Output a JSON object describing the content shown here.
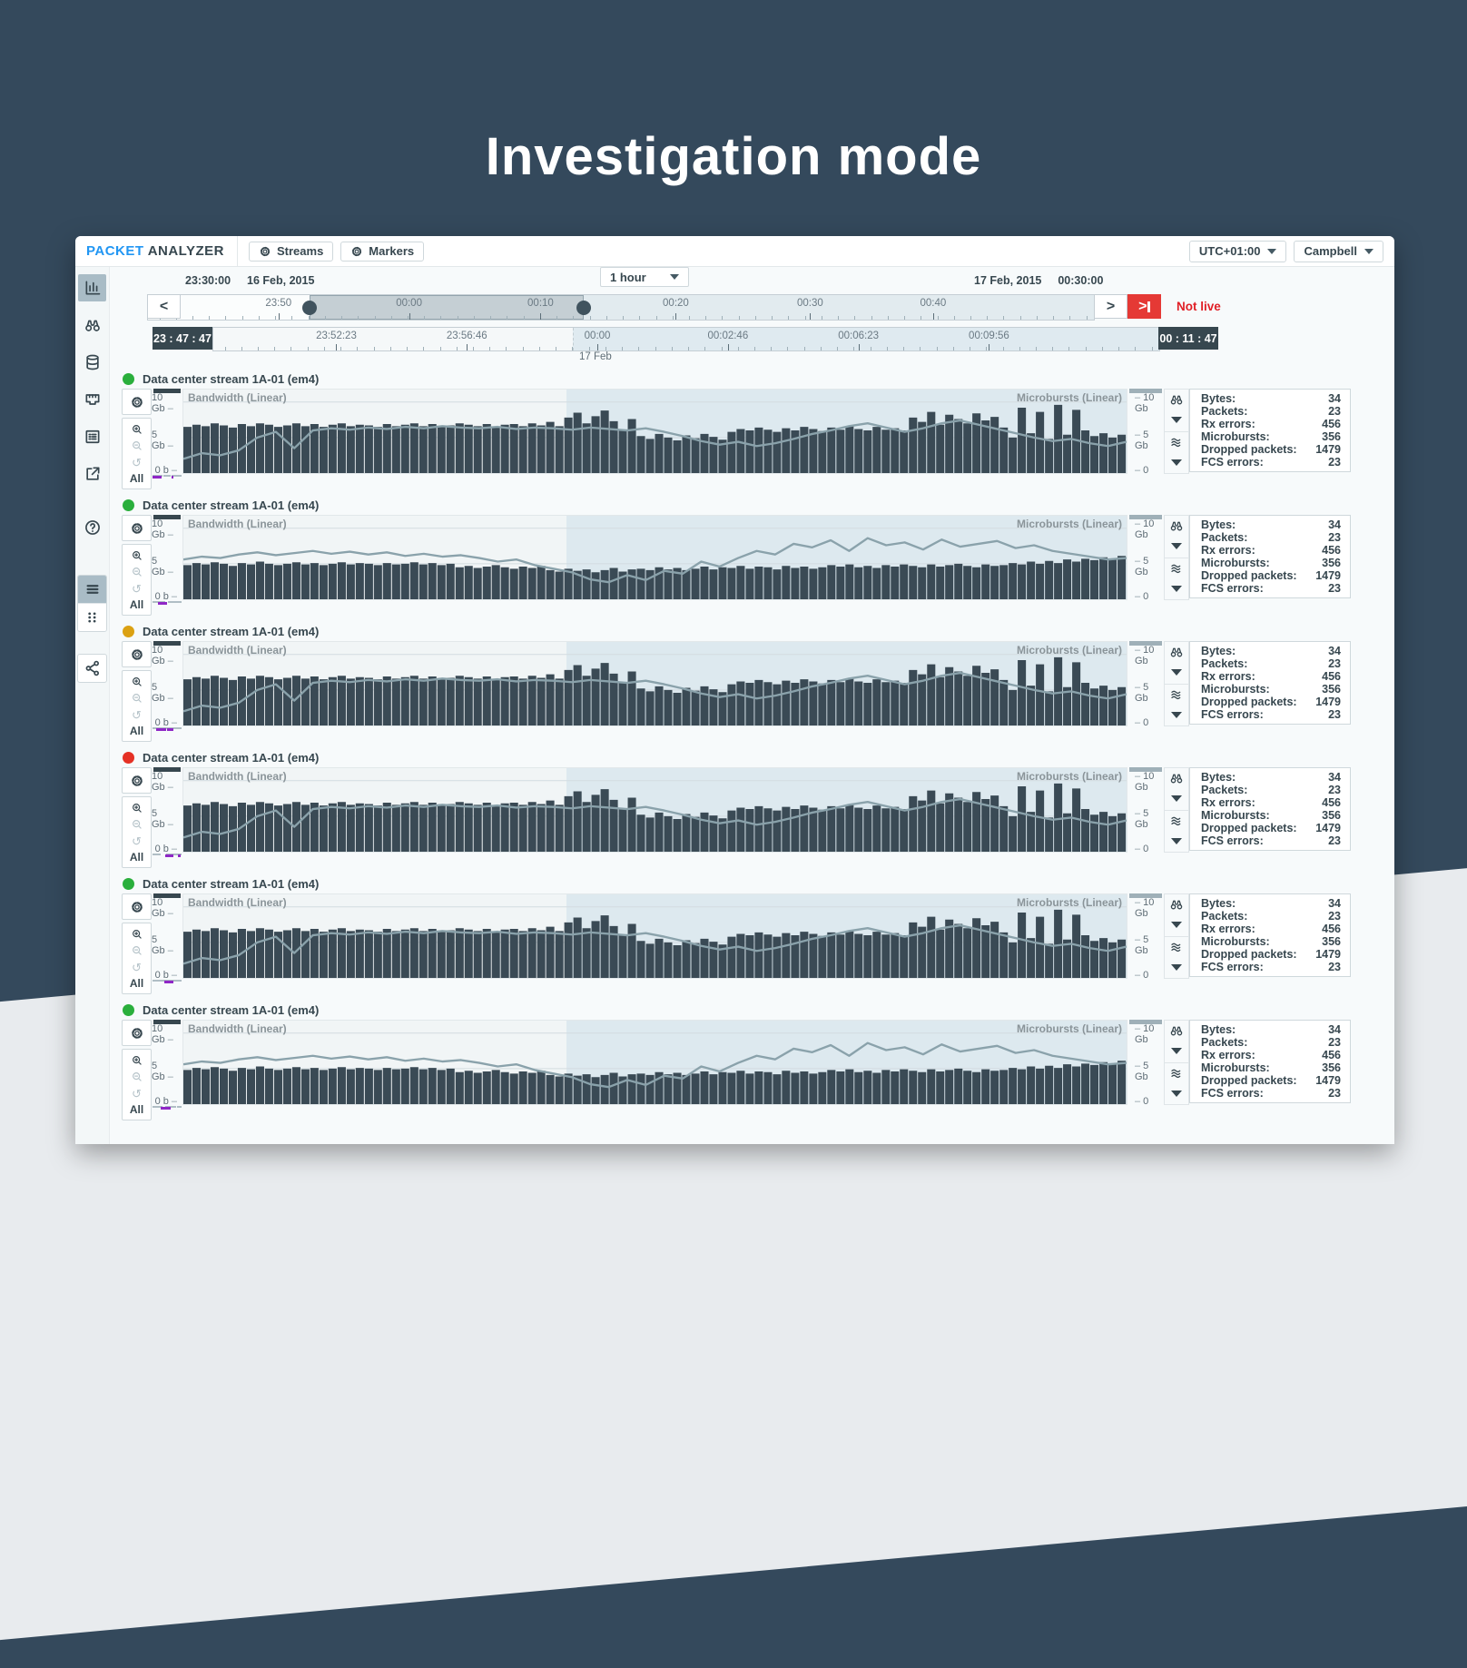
{
  "page": {
    "title": "Investigation mode"
  },
  "header": {
    "brand_part1": "PACKET",
    "brand_part2": "ANALYZER",
    "streams_button": "Streams",
    "markers_button": "Markers",
    "timezone": "UTC+01:00",
    "user": "Campbell"
  },
  "sidebar": {
    "items": [
      {
        "icon": "bar-chart-icon",
        "name": "sidebar-item-charts",
        "active": true
      },
      {
        "icon": "binoculars-icon",
        "name": "sidebar-item-search",
        "active": false
      },
      {
        "icon": "database-icon",
        "name": "sidebar-item-storage",
        "active": false
      },
      {
        "icon": "ethernet-port-icon",
        "name": "sidebar-item-interfaces",
        "active": false
      },
      {
        "icon": "list-details-icon",
        "name": "sidebar-item-details",
        "active": false
      },
      {
        "icon": "external-link-icon",
        "name": "sidebar-item-open",
        "active": false
      }
    ],
    "help_icon": "help-icon",
    "view_toggle": [
      {
        "icon": "list-view-icon",
        "name": "view-list-button",
        "active": true
      },
      {
        "icon": "grid-view-icon",
        "name": "view-grid-button",
        "active": false
      }
    ],
    "share_icon": "share-icon"
  },
  "timebar": {
    "left_time": "23:30:00",
    "left_date": "16 Feb, 2015",
    "right_date": "17 Feb, 2015",
    "right_time": "00:30:00",
    "range_select": "1 hour",
    "not_live": "Not live",
    "start_badge": "23 : 47 : 47",
    "end_badge": "00 : 11 : 47",
    "day_label": "17 Feb",
    "overview_ticks": [
      {
        "label": "23:50",
        "pos": 13.8
      },
      {
        "label": "00:00",
        "pos": 27.6
      },
      {
        "label": "00:10",
        "pos": 41.5
      },
      {
        "label": "00:20",
        "pos": 55.8
      },
      {
        "label": "00:30",
        "pos": 70.0
      },
      {
        "label": "00:40",
        "pos": 83.0
      }
    ],
    "selection": {
      "start": 17.1,
      "end": 46.1
    },
    "detail_ticks": [
      {
        "label": "23:52:23",
        "pos": 13.0
      },
      {
        "label": "23:56:46",
        "pos": 26.8
      },
      {
        "label": "00:00",
        "pos": 40.6
      },
      {
        "label": "00:02:46",
        "pos": 54.4
      },
      {
        "label": "00:06:23",
        "pos": 68.2
      },
      {
        "label": "00:09:56",
        "pos": 82.0
      }
    ],
    "detail_highlight_start": 38.0
  },
  "chart_labels": {
    "left": "Bandwidth (Linear)",
    "right": "Microbursts (Linear)"
  },
  "axis": {
    "left": [
      "10 Gb",
      "5 Gb",
      "0 b"
    ],
    "right": [
      "10 Gb",
      "5 Gb",
      "0"
    ],
    "all_label": "All"
  },
  "stats": {
    "labels": [
      "Bytes:",
      "Packets:",
      "Rx errors:",
      "Microbursts:",
      "Dropped packets:",
      "FCS errors:"
    ],
    "values": [
      "34",
      "23",
      "456",
      "356",
      "1479",
      "23"
    ]
  },
  "colors": {
    "brand_blue": "#2196f3",
    "live_red": "#e53935",
    "dark_slate": "#37474f",
    "bar_fill": "#3a4a55",
    "line_stroke": "#8aa2ab",
    "purple_marker": "#8f27c6",
    "gray_marker": "#b0bec5",
    "marker_palette": {
      "r": "#e53935",
      "o": "#f57c00",
      "y": "#fbc02d",
      "g": "#43a047",
      "t": "#26a69a",
      "c": "#00acc1"
    }
  },
  "series": {
    "bars_a": [
      65,
      68,
      66,
      70,
      67,
      64,
      69,
      66,
      70,
      68,
      65,
      67,
      70,
      66,
      69,
      65,
      68,
      70,
      66,
      68,
      67,
      65,
      69,
      66,
      68,
      70,
      66,
      69,
      65,
      67,
      70,
      68,
      66,
      69,
      65,
      68,
      69,
      66,
      70,
      67,
      72,
      66,
      78,
      85,
      70,
      80,
      88,
      73,
      60,
      76,
      52,
      48,
      55,
      50,
      46,
      53,
      49,
      55,
      51,
      47,
      58,
      62,
      60,
      64,
      61,
      58,
      63,
      60,
      65,
      62,
      59,
      64,
      61,
      66,
      62,
      60,
      65,
      61,
      63,
      60,
      78,
      72,
      86,
      68,
      82,
      76,
      70,
      84,
      74,
      79,
      64,
      50,
      92,
      56,
      86,
      48,
      96,
      54,
      89,
      60,
      52,
      56,
      50,
      54
    ],
    "line_a": [
      20,
      28,
      25,
      32,
      50,
      58,
      35,
      60,
      63,
      61,
      64,
      62,
      65,
      63,
      66,
      64,
      63,
      65,
      62,
      64,
      63,
      61,
      64,
      62,
      60,
      63,
      58,
      52,
      45,
      40,
      44,
      38,
      42,
      48,
      55,
      60,
      66,
      70,
      64,
      58,
      63,
      70,
      74,
      68,
      62,
      56,
      50,
      45,
      48,
      42,
      38,
      44
    ],
    "bars_b": [
      48,
      51,
      49,
      52,
      50,
      47,
      51,
      49,
      53,
      50,
      48,
      50,
      52,
      49,
      51,
      48,
      50,
      52,
      49,
      51,
      50,
      48,
      51,
      49,
      50,
      52,
      49,
      51,
      48,
      50,
      45,
      47,
      44,
      46,
      48,
      45,
      43,
      46,
      44,
      47,
      41,
      39,
      43,
      40,
      42,
      38,
      41,
      44,
      39,
      42,
      43,
      41,
      45,
      42,
      44,
      41,
      43,
      46,
      42,
      45,
      44,
      47,
      43,
      46,
      45,
      42,
      47,
      44,
      46,
      43,
      45,
      48,
      46,
      49,
      45,
      47,
      44,
      48,
      46,
      49,
      47,
      45,
      49,
      46,
      48,
      50,
      47,
      45,
      49,
      47,
      48,
      51,
      49,
      53,
      50,
      54,
      51,
      56,
      53,
      57,
      55,
      59,
      57,
      61
    ],
    "line_b": [
      56,
      60,
      58,
      63,
      66,
      62,
      65,
      68,
      64,
      67,
      63,
      66,
      61,
      64,
      60,
      62,
      58,
      53,
      56,
      48,
      43,
      38,
      28,
      24,
      34,
      27,
      40,
      36,
      53,
      46,
      58,
      68,
      63,
      78,
      73,
      83,
      68,
      86,
      76,
      80,
      70,
      84,
      74,
      78,
      82,
      72,
      76,
      68,
      64,
      60,
      56,
      58
    ],
    "markers_a": "-gyr-or--ryy-g----orro-yr-----g-ry-oyr-ryo-yrr-roy-ryr-or-tgy-ryg--toyr-yro-gy-oyy-o--rry-ro-yr--orr-oyrogy-ryr-tr-ygr-",
    "markers_b": "--ryo--yy-r---g-oy--rro---ryy--t--or--ryr-gy--o-ryo--rry--gor--yro--ryy--tr--oy--rgy--ro--yrr--o--gy--ryo--rr--yor--gy-"
  },
  "streams": [
    {
      "title": "Data center stream 1A-01 (em4)",
      "dot_color": "#2aaf3c",
      "bars": "bars_a",
      "line": "line_a",
      "markers": "markers_a",
      "gray_lines": [
        [
          2,
          35
        ],
        [
          38,
          62
        ],
        [
          64,
          97
        ]
      ],
      "purple_lines": [
        [
          3,
          31
        ],
        [
          64,
          72
        ]
      ]
    },
    {
      "title": "Data center stream 1A-01 (em4)",
      "dot_color": "#2aaf3c",
      "bars": "bars_b",
      "line": "line_b",
      "markers": "markers_b",
      "gray_lines": [
        [
          2,
          45
        ],
        [
          52,
          97
        ]
      ],
      "purple_lines": [
        [
          22,
          50
        ]
      ]
    },
    {
      "title": "Data center stream 1A-01 (em4)",
      "dot_color": "#dba112",
      "bars": "bars_a",
      "line": "line_a",
      "markers": "markers_a",
      "gray_lines": [
        [
          2,
          97
        ]
      ],
      "purple_lines": [
        [
          15,
          47
        ],
        [
          50,
          71
        ]
      ]
    },
    {
      "title": "Data center stream 1A-01 (em4)",
      "dot_color": "#e53125",
      "bars": "bars_a",
      "line": "line_a",
      "markers": "markers_b",
      "gray_lines": [
        [
          2,
          30
        ],
        [
          46,
          97
        ]
      ],
      "purple_lines": [
        [
          44,
          72
        ],
        [
          85,
          93
        ]
      ]
    },
    {
      "title": "Data center stream 1A-01 (em4)",
      "dot_color": "#2aaf3c",
      "bars": "bars_a",
      "line": "line_a",
      "markers": "markers_a",
      "gray_lines": [
        [
          2,
          97
        ]
      ],
      "purple_lines": [
        [
          40,
          70
        ]
      ]
    },
    {
      "title": "Data center stream 1A-01 (em4)",
      "dot_color": "#2aaf3c",
      "bars": "bars_b",
      "line": "line_b",
      "markers": "markers_b",
      "gray_lines": [
        [
          2,
          35
        ],
        [
          45,
          80
        ],
        [
          82,
          97
        ]
      ],
      "purple_lines": [
        [
          28,
          62
        ]
      ]
    }
  ]
}
